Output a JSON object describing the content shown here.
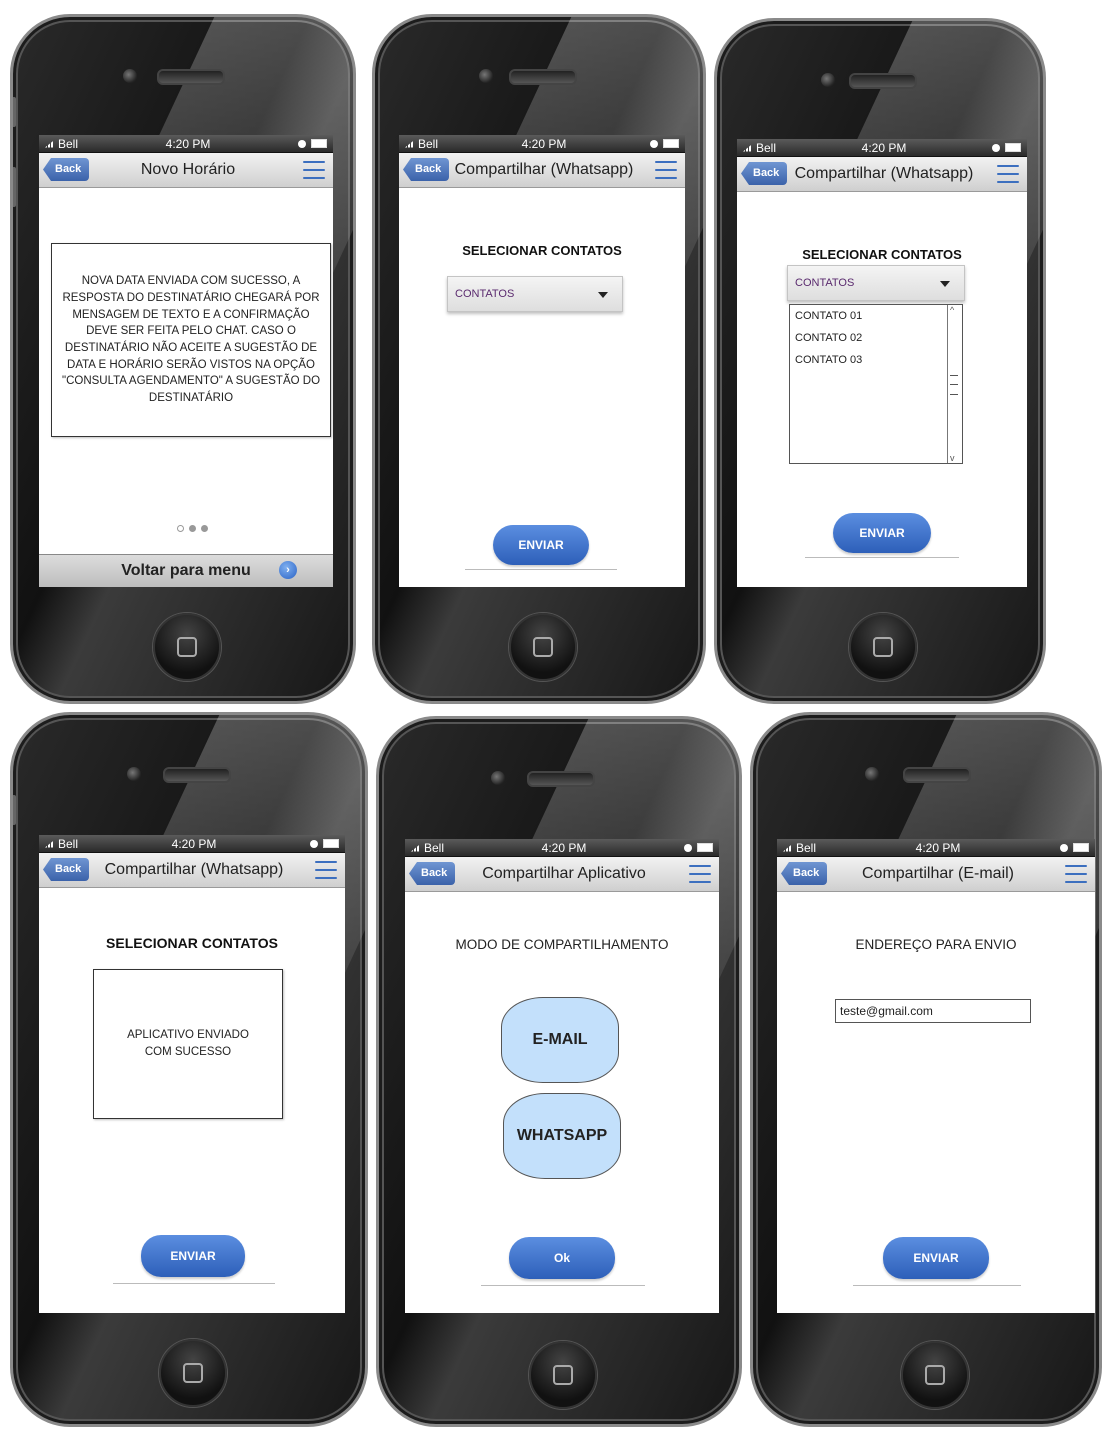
{
  "status": {
    "carrier": "Bell",
    "time": "4:20 PM"
  },
  "nav": {
    "back_label": "Back"
  },
  "screens": {
    "s1": {
      "title": "Novo Horário",
      "message": "NOVA DATA ENVIADA COM SUCESSO, A RESPOSTA DO DESTINATÁRIO CHEGARÁ POR MENSAGEM DE TEXTO E A CONFIRMAÇÃO DEVE SER FEITA PELO CHAT. CASO O DESTINATÁRIO NÃO ACEITE A SUGESTÃO DE DATA E HORÁRIO SERÃO VISTOS NA OPÇÃO \"CONSULTA AGENDAMENTO\" A SUGESTÃO DO DESTINATÁRIO",
      "footer_label": "Voltar para menu",
      "page_dots": 3,
      "active_dot": 1
    },
    "s2": {
      "title": "Compartilhar (Whatsapp)",
      "heading": "SELECIONAR CONTATOS",
      "dropdown_label": "CONTATOS",
      "button_label": "ENVIAR"
    },
    "s3": {
      "title": "Compartilhar (Whatsapp)",
      "heading": "SELECIONAR CONTATOS",
      "dropdown_label": "CONTATOS",
      "contacts": [
        "CONTATO 01",
        "CONTATO 02",
        "CONTATO 03"
      ],
      "button_label": "ENVIAR"
    },
    "s4": {
      "title": "Compartilhar (Whatsapp)",
      "heading": "SELECIONAR CONTATOS",
      "message": "APLICATIVO ENVIADO COM SUCESSO",
      "button_label": "ENVIAR"
    },
    "s5": {
      "title": "Compartilhar Aplicativo",
      "heading": "MODO DE COMPARTILHAMENTO",
      "option_email": "E-MAIL",
      "option_whatsapp": "WHATSAPP",
      "button_label": "Ok"
    },
    "s6": {
      "title": "Compartilhar (E-mail)",
      "heading": "ENDEREÇO PARA ENVIO",
      "email_value": "teste@gmail.com",
      "button_label": "ENVIAR"
    }
  },
  "colors": {
    "accent": "#3b62aa",
    "option_fill": "#c3e0fb"
  }
}
